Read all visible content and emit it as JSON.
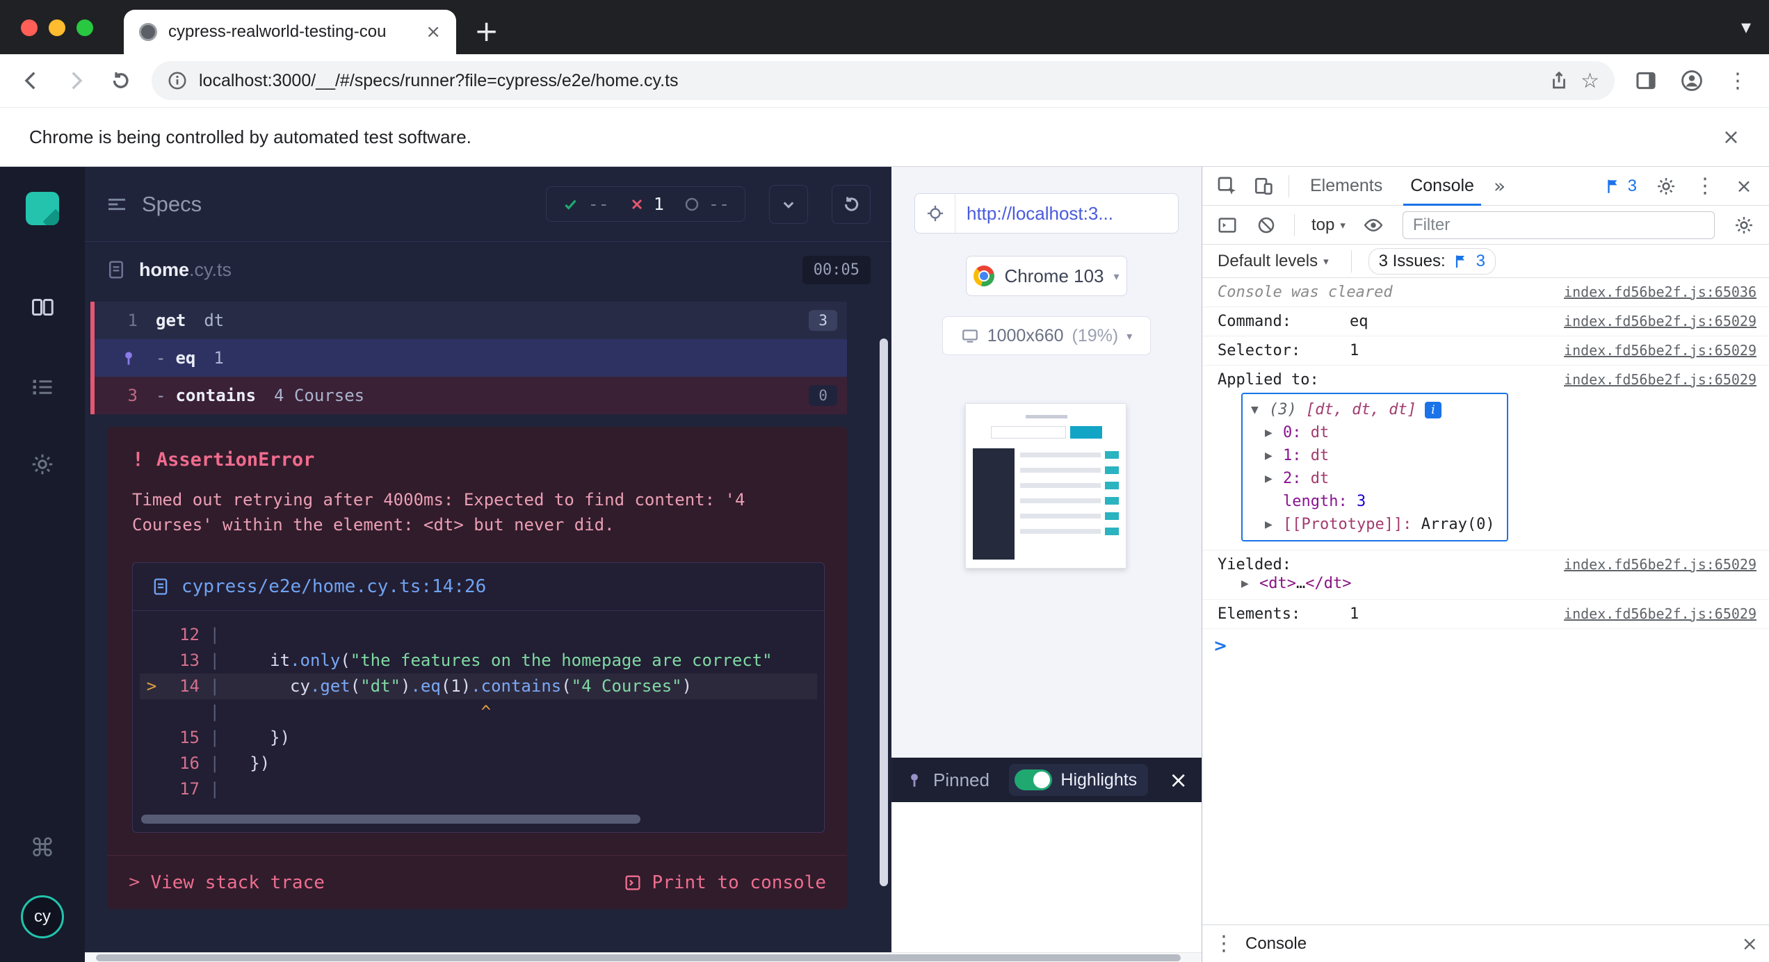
{
  "colors": {
    "cypress_red": "#e45770",
    "cypress_green": "#1fa971",
    "pin_purple": "#8b7ae8",
    "devtools_blue": "#1a73e8",
    "cypress_teal": "#23c3ae",
    "link_blue": "#4a5bdc",
    "error_pink": "#ee6e90"
  },
  "icons": {
    "close": "×",
    "plus": "+",
    "star": "☆",
    "kebab": "⋮",
    "more_tabs": "»",
    "caret_down": "▾",
    "command_key": "⌘",
    "tri_open": "▼",
    "tri_closed": "▶",
    "chevron_right": ">",
    "prompt": ">"
  },
  "browser": {
    "tab_title": "cypress-realworld-testing-cou",
    "url": "localhost:3000/__/#/specs/runner?file=cypress/e2e/home.cy.ts",
    "infobar_message": "Chrome is being controlled by automated test software."
  },
  "runner": {
    "sidebar": {
      "avatar": "cy"
    },
    "header": {
      "title": "Specs",
      "passed": "--",
      "failed": "1",
      "pending": "--"
    },
    "spec": {
      "name": "home",
      "ext": ".cy.ts",
      "duration": "00:05"
    },
    "commands": {
      "get": {
        "num": "1",
        "name": "get",
        "message": "dt",
        "badge": "3"
      },
      "eq": {
        "dash": "-",
        "name": "eq",
        "message": "1"
      },
      "contains": {
        "num": "3",
        "dash": "-",
        "name": "contains",
        "message": "4 Courses",
        "badge": "0"
      }
    },
    "error": {
      "bang": "!",
      "title": "AssertionError",
      "message": "Timed out retrying after 4000ms: Expected to find content: '4 Courses' within the element: <dt> but never did."
    },
    "code_frame": {
      "file": "cypress/e2e/home.cy.ts:14:26",
      "lines": [
        {
          "marker": "",
          "num": "12",
          "tokens": []
        },
        {
          "marker": "",
          "num": "13",
          "tokens": [
            [
              "pl",
              "    it"
            ],
            [
              "fn",
              ".only"
            ],
            [
              "pl",
              "("
            ],
            [
              "st",
              "\"the features on the homepage are correct\""
            ]
          ]
        },
        {
          "marker": ">",
          "num": "14",
          "tokens": [
            [
              "pl",
              "      cy"
            ],
            [
              "fn",
              ".get"
            ],
            [
              "pl",
              "("
            ],
            [
              "st",
              "\"dt\""
            ],
            [
              "pl",
              ")"
            ],
            [
              "fn",
              ".eq"
            ],
            [
              "pl",
              "("
            ],
            [
              "nu",
              "1"
            ],
            [
              "pl",
              ")"
            ],
            [
              "fn",
              ".contains"
            ],
            [
              "pl",
              "("
            ],
            [
              "st",
              "\"4 Courses\""
            ],
            [
              "pl",
              ")"
            ]
          ]
        },
        {
          "marker": "",
          "num": "",
          "tokens": [
            [
              "ca",
              "                         ^"
            ]
          ]
        },
        {
          "marker": "",
          "num": "15",
          "tokens": [
            [
              "pl",
              "    })"
            ]
          ]
        },
        {
          "marker": "",
          "num": "16",
          "tokens": [
            [
              "pl",
              "  })"
            ]
          ]
        },
        {
          "marker": "",
          "num": "17",
          "tokens": []
        }
      ]
    },
    "footer": {
      "stack_chevron": ">",
      "stack_label": "View stack trace",
      "print_label": "Print to console"
    }
  },
  "preview": {
    "url": "http://localhost:3...",
    "browser_label": "Chrome 103",
    "viewport": "1000x660",
    "zoom": "(19%)",
    "pinned_label": "Pinned",
    "highlights_label": "Highlights"
  },
  "devtools": {
    "tabs": {
      "elements": "Elements",
      "console": "Console"
    },
    "issues_count": "3",
    "toolbar": {
      "context": "top",
      "filter_placeholder": "Filter"
    },
    "levels": {
      "label": "Default levels",
      "issues_label": "3 Issues:",
      "issues_count": "3"
    },
    "console": {
      "cleared_text": "Console was cleared",
      "cleared_src": "index.fd56be2f.js:65036",
      "command_label": "Command:",
      "command_value": "eq",
      "command_src": "index.fd56be2f.js:65029",
      "selector_label": "Selector:",
      "selector_value": "1",
      "selector_src": "index.fd56be2f.js:65029",
      "applied_label": "Applied to:",
      "applied_src": "index.fd56be2f.js:65029",
      "array": {
        "preview_count": "(3)",
        "preview_body": "[dt, dt, dt]",
        "info": "i",
        "items": [
          {
            "k": "0:",
            "v": "dt"
          },
          {
            "k": "1:",
            "v": "dt"
          },
          {
            "k": "2:",
            "v": "dt"
          }
        ],
        "length_key": "length:",
        "length_value": "3",
        "proto_key": "[[Prototype]]:",
        "proto_value": "Array(0)"
      },
      "yielded_label": "Yielded:",
      "yielded_src": "index.fd56be2f.js:65029",
      "yielded_open": "<dt>",
      "yielded_mid": "…",
      "yielded_close": "</dt>",
      "elements_label": "Elements:",
      "elements_value": "1",
      "elements_src": "index.fd56be2f.js:65029"
    },
    "drawer_title": "Console"
  }
}
